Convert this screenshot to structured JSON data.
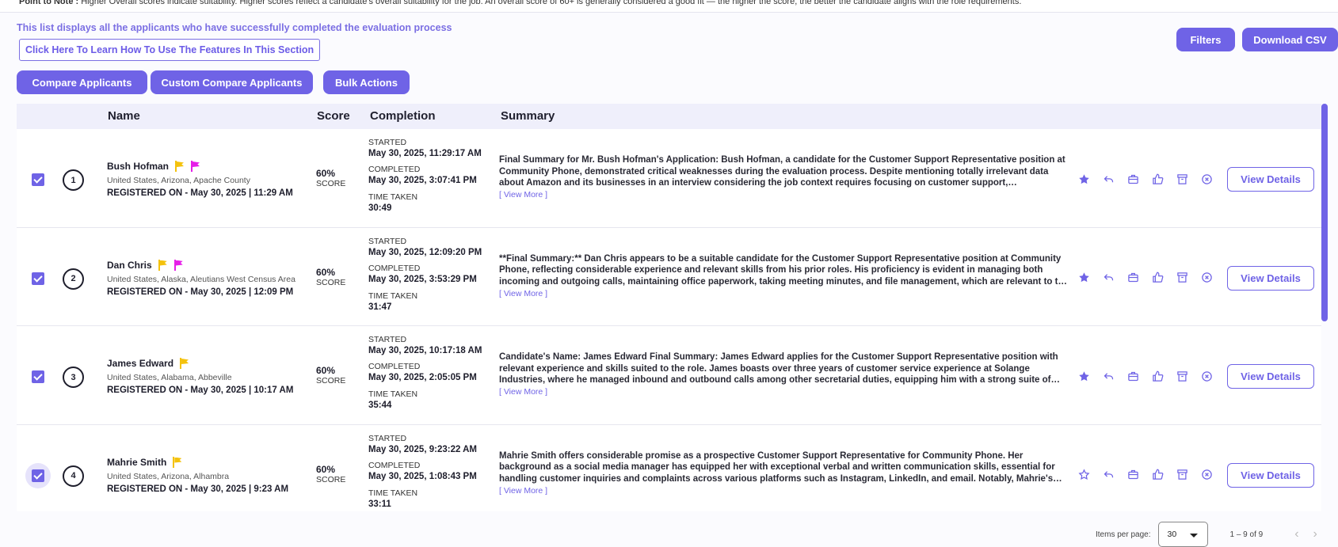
{
  "top_note": {
    "prefix": "Point to Note :",
    "text": " Higher Overall scores indicate suitability. Higher scores reflect a candidate's overall suitability for the job. An overall score of 60+ is generally considered a good fit — the higher the score, the better the candidate aligns with the role requirements."
  },
  "info_text": "This list displays all the applicants who have successfully completed the evaluation process",
  "learn_link": "Click Here To Learn How To Use The Features In This Section",
  "buttons": {
    "compare": "Compare Applicants",
    "custom_compare": "Custom Compare Applicants",
    "bulk": "Bulk Actions",
    "filters": "Filters",
    "csv": "Download CSV"
  },
  "columns": {
    "name": "Name",
    "score": "Score",
    "completion": "Completion",
    "summary": "Summary"
  },
  "labels": {
    "started": "STARTED",
    "completed": "COMPLETED",
    "time_taken": "TIME TAKEN",
    "score": "SCORE",
    "view_more": "[ View More ]",
    "view_details": "View Details"
  },
  "colors": {
    "accent": "#6f63e6",
    "flag_yellow": "#f4c20d",
    "flag_magenta": "#e61ee8"
  },
  "rows": [
    {
      "index": "1",
      "name": "Bush Hofman",
      "flags": [
        "yellow",
        "magenta"
      ],
      "location": "United States, Arizona, Apache County",
      "registered": "REGISTERED ON - May 30, 2025 | 11:29 AM",
      "score": "60%",
      "started": "May 30, 2025, 11:29:17 AM",
      "completed": "May 30, 2025, 3:07:41 PM",
      "time_taken": "30:49",
      "summary": "Final Summary for Mr. Bush Hofman's Application: Bush Hofman, a candidate for the Customer Support Representative position at Community Phone, demonstrated critical weaknesses during the evaluation process. Despite mentioning totally irrelevant data about Amazon and its businesses in an interview considering the job context requires focusing on customer support, communication and problem solving skills.",
      "starred": true,
      "checked": true
    },
    {
      "index": "2",
      "name": "Dan Chris",
      "flags": [
        "yellow",
        "magenta"
      ],
      "location": "United States, Alaska, Aleutians West Census Area",
      "registered": "REGISTERED ON - May 30, 2025 | 12:09 PM",
      "score": "60%",
      "started": "May 30, 2025, 12:09:20 PM",
      "completed": "May 30, 2025, 3:53:29 PM",
      "time_taken": "31:47",
      "summary": "**Final Summary:** Dan Chris appears to be a suitable candidate for the Customer Support Representative position at Community Phone, reflecting considerable experience and relevant skills from his prior roles. His proficiency is evident in managing both incoming and outgoing calls, maintaining office paperwork, taking meeting minutes, and file management, which are relevant to the role.",
      "starred": true,
      "checked": true
    },
    {
      "index": "3",
      "name": "James Edward",
      "flags": [
        "yellow"
      ],
      "location": "United States, Alabama, Abbeville",
      "registered": "REGISTERED ON - May 30, 2025 | 10:17 AM",
      "score": "60%",
      "started": "May 30, 2025, 10:17:18 AM",
      "completed": "May 30, 2025, 2:05:05 PM",
      "time_taken": "35:44",
      "summary": "Candidate's Name: James Edward Final Summary: James Edward applies for the Customer Support Representative position with relevant experience and skills suited to the role. James boasts over three years of customer service experience at Solange Industries, where he managed inbound and outbound calls among other secretarial duties, equipping him with a strong suite of skills.",
      "starred": true,
      "checked": true
    },
    {
      "index": "4",
      "name": "Mahrie Smith",
      "flags": [
        "yellow"
      ],
      "location": "United States, Arizona, Alhambra",
      "registered": "REGISTERED ON - May 30, 2025 | 9:23 AM",
      "score": "60%",
      "started": "May 30, 2025, 9:23:22 AM",
      "completed": "May 30, 2025, 1:08:43 PM",
      "time_taken": "33:11",
      "summary": "Mahrie Smith offers considerable promise as a prospective Customer Support Representative for Community Phone. Her background as a social media manager has equipped her with exceptional verbal and written communication skills, essential for handling customer inquiries and complaints across various platforms such as Instagram, LinkedIn, and email. Notably, Mahrie's experience is relevant.",
      "starred": false,
      "checked": true
    }
  ],
  "pagination": {
    "label": "Items per page:",
    "per_page": "30",
    "range": "1 – 9 of 9"
  }
}
